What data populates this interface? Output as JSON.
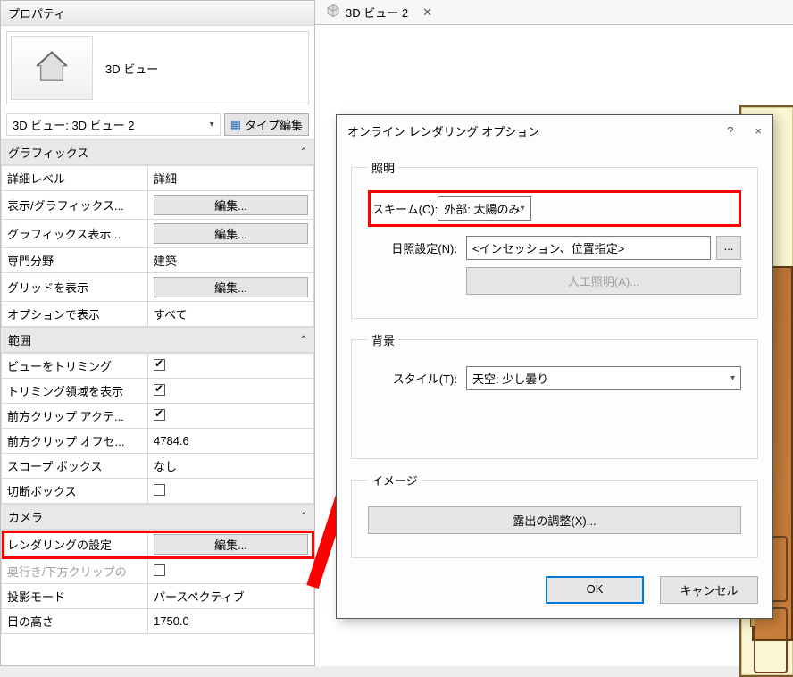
{
  "panel": {
    "title": "プロパティ",
    "family": "3D ビュー",
    "instance": "3D ビュー: 3D ビュー 2",
    "type_edit_label": "タイプ編集"
  },
  "groups": {
    "graphics": {
      "title": "グラフィックス",
      "rows": {
        "detail_level": {
          "label": "詳細レベル",
          "value": "詳細"
        },
        "vis_graphics": {
          "label": "表示/グラフィックス...",
          "btn": "編集..."
        },
        "graphics_display": {
          "label": "グラフィックス表示...",
          "btn": "編集..."
        },
        "discipline": {
          "label": "専門分野",
          "value": "建築"
        },
        "show_grid": {
          "label": "グリッドを表示",
          "btn": "編集..."
        },
        "show_by_option": {
          "label": "オプションで表示",
          "value": "すべて"
        }
      }
    },
    "range": {
      "title": "範囲",
      "rows": {
        "trim_view": {
          "label": "ビューをトリミング",
          "checked": true
        },
        "show_trim": {
          "label": "トリミング領域を表示",
          "checked": true
        },
        "front_clip_act": {
          "label": "前方クリップ アクテ...",
          "checked": true
        },
        "front_clip_off": {
          "label": "前方クリップ オフセ...",
          "value": "4784.6"
        },
        "scope_box": {
          "label": "スコープ ボックス",
          "value": "なし"
        },
        "section_box": {
          "label": "切断ボックス",
          "checked": false
        }
      }
    },
    "camera": {
      "title": "カメラ",
      "rows": {
        "render_settings": {
          "label": "レンダリングの設定",
          "btn": "編集..."
        },
        "depth_clip": {
          "label": "奥行き/下方クリップの",
          "checked": false
        },
        "projection": {
          "label": "投影モード",
          "value": "パースペクティブ"
        },
        "eye_height": {
          "label": "目の高さ",
          "value": "1750.0"
        }
      }
    }
  },
  "tab": {
    "label": "3D ビュー 2"
  },
  "dialog": {
    "title": "オンライン レンダリング オプション",
    "help": "?",
    "close": "×",
    "lighting": {
      "legend": "照明",
      "scheme_label": "スキーム(C):",
      "scheme_value": "外部: 太陽のみ",
      "sun_label": "日照設定(N):",
      "sun_value": "<インセッション、位置指定>",
      "ellipsis": "...",
      "artificial": "人工照明(A)..."
    },
    "background": {
      "legend": "背景",
      "style_label": "スタイル(T):",
      "style_value": "天空: 少し曇り"
    },
    "image": {
      "legend": "イメージ",
      "exposure": "露出の調整(X)..."
    },
    "ok": "OK",
    "cancel": "キャンセル"
  },
  "chart_data": null
}
